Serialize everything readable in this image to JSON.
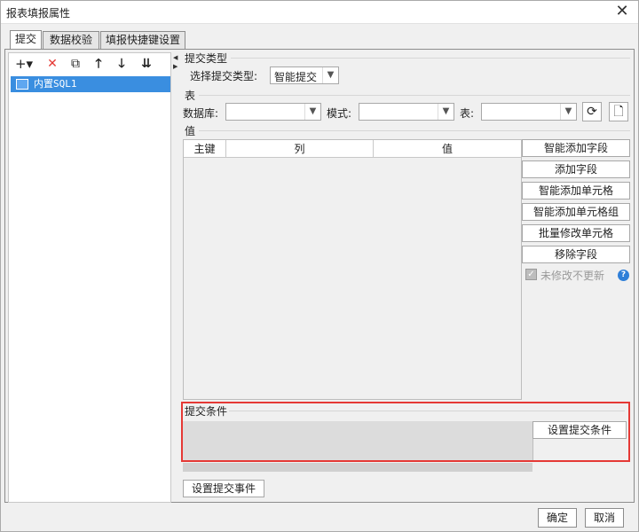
{
  "window": {
    "title": "报表填报属性",
    "close_glyph": "✕"
  },
  "tabs": [
    {
      "label": "提交"
    },
    {
      "label": "数据校验"
    },
    {
      "label": "填报快捷键设置"
    }
  ],
  "left": {
    "toolbar": {
      "add_glyph": "+▾",
      "delete_glyph": "✕",
      "copy_glyph": "⧉",
      "up_glyph": "🡑",
      "down_glyph": "🡓",
      "sort_glyph": "⇊"
    },
    "tree_item": "内置SQL1"
  },
  "right": {
    "submit_type": {
      "section": "提交类型",
      "label": "选择提交类型:",
      "value": "智能提交"
    },
    "table": {
      "section": "表",
      "db_label": "数据库:",
      "schema_label": "模式:",
      "table_label": "表:",
      "db_value": "",
      "schema_value": "",
      "table_value": ""
    },
    "values": {
      "section": "值",
      "columns": [
        "主键",
        "列",
        "值"
      ]
    },
    "side_buttons": [
      "智能添加字段",
      "添加字段",
      "智能添加单元格",
      "智能添加单元格组",
      "批量修改单元格",
      "移除字段"
    ],
    "unchanged_checkbox": "未修改不更新",
    "condition": {
      "section": "提交条件",
      "button": "设置提交条件"
    },
    "event_button": "设置提交事件"
  },
  "footer": {
    "ok": "确定",
    "cancel": "取消"
  },
  "colors": {
    "selection": "#3a8ee0",
    "highlight": "#e53935",
    "delete_red": "#e53935",
    "help_blue": "#2f7fd8"
  }
}
